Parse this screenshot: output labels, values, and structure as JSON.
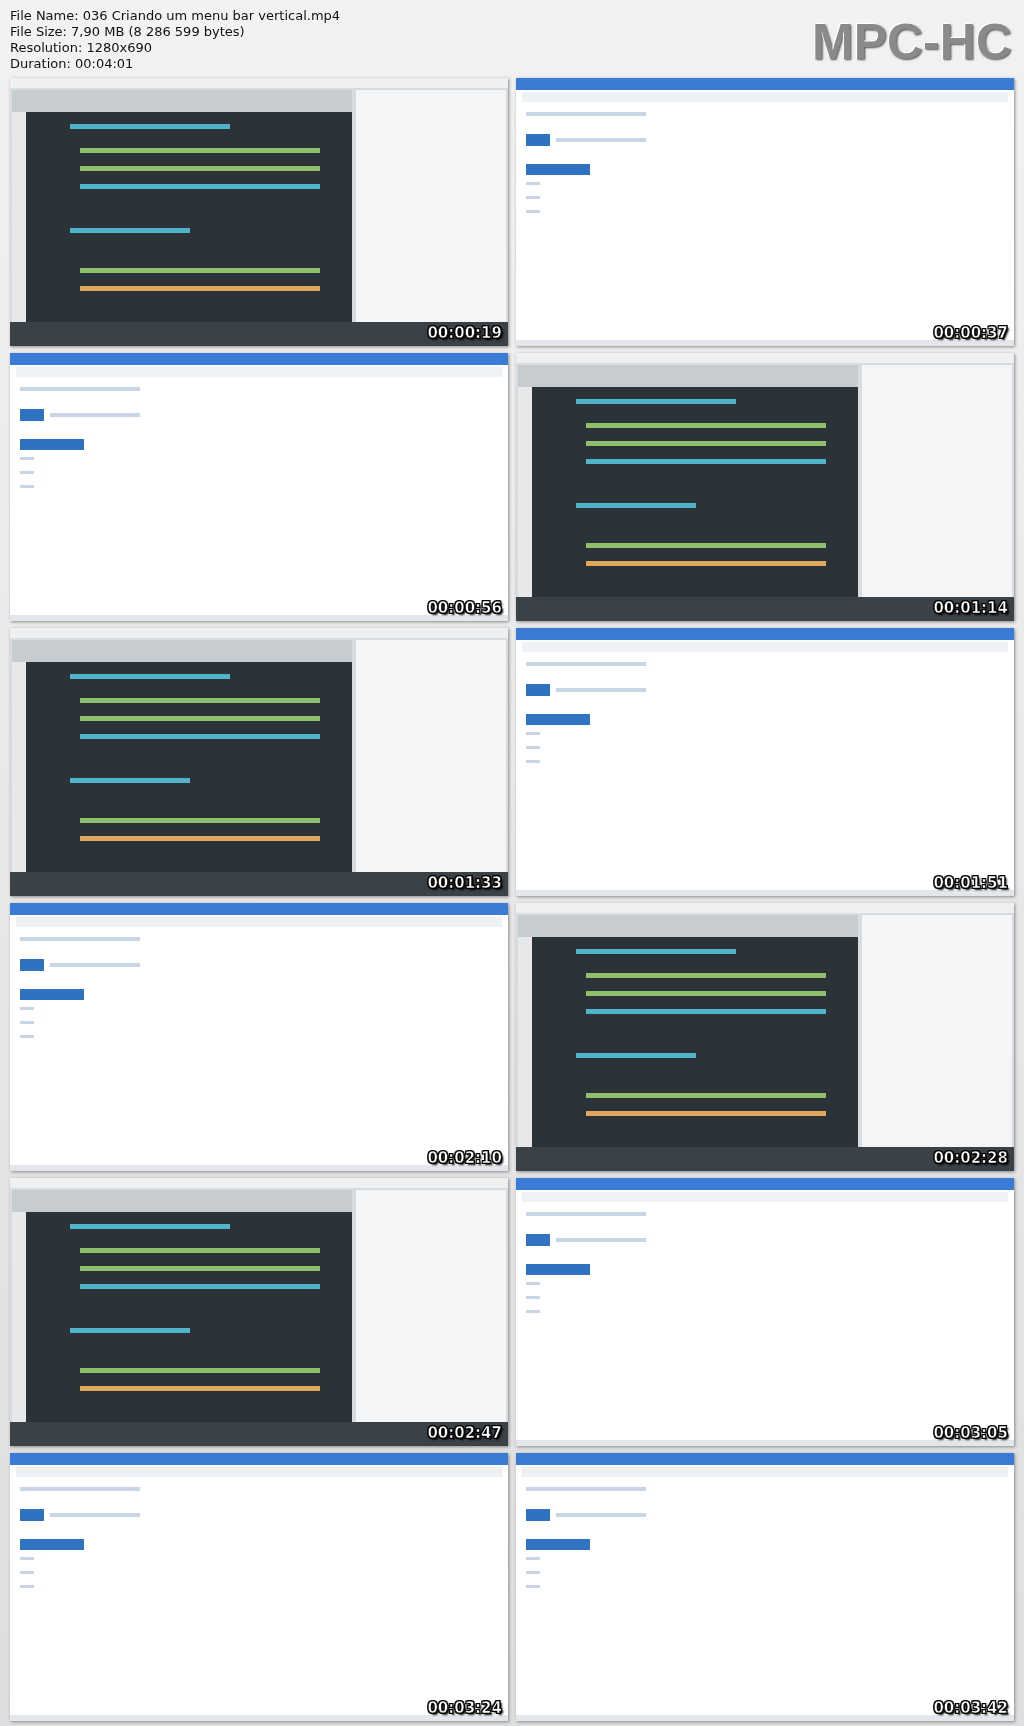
{
  "header_lines": [
    "File Name: 036 Criando um menu bar vertical.mp4",
    "File Size: 7,90 MB (8 286 599 bytes)",
    "Resolution: 1280x690",
    "Duration: 00:04:01"
  ],
  "logo": "MPC-HC",
  "frames": [
    {
      "kind": "picture",
      "timestamp": "00:00:19"
    },
    {
      "kind": "picture",
      "timestamp": "00:00:37"
    },
    {
      "kind": "picture",
      "timestamp": "00:00:56"
    },
    {
      "kind": "picture",
      "timestamp": "00:01:14"
    },
    {
      "kind": "picture",
      "timestamp": "00:01:33"
    },
    {
      "kind": "picture",
      "timestamp": "00:01:51"
    },
    {
      "kind": "picture",
      "timestamp": "00:02:10"
    },
    {
      "kind": "picture",
      "timestamp": "00:02:28"
    },
    {
      "kind": "picture",
      "timestamp": "00:02:47"
    },
    {
      "kind": "picture",
      "timestamp": "00:03:05"
    },
    {
      "kind": "picture",
      "timestamp": "00:03:24"
    },
    {
      "kind": "picture",
      "timestamp": "00:03:42"
    }
  ]
}
